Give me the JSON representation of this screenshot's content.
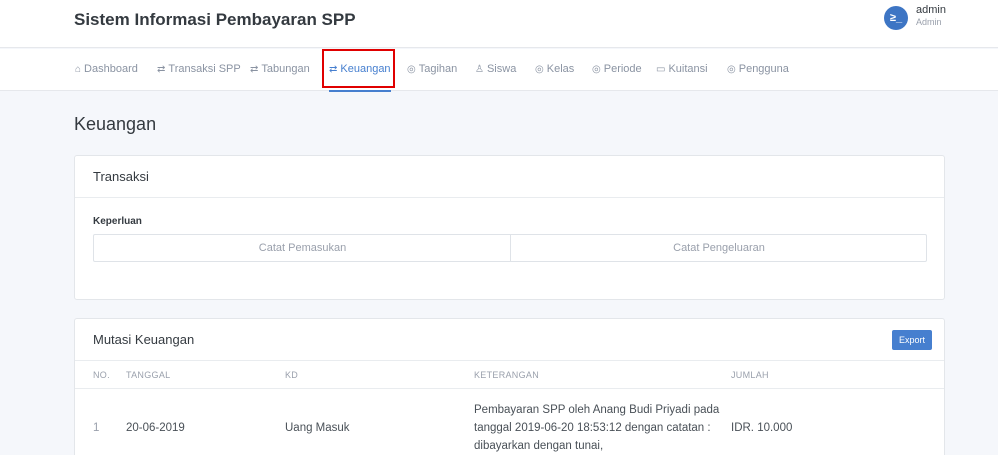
{
  "header": {
    "title": "Sistem Informasi Pembayaran SPP",
    "user_name": "admin",
    "user_role": "Admin",
    "avatar_glyph": "≥_",
    "avatar_icon": "terminal-icon"
  },
  "nav": {
    "items": [
      {
        "label": "Dashboard",
        "icon": "home-icon",
        "glyph": "⌂"
      },
      {
        "label": "Transaksi SPP",
        "icon": "repeat-icon",
        "glyph": "⇄"
      },
      {
        "label": "Tabungan",
        "icon": "repeat-icon",
        "glyph": "⇄"
      },
      {
        "label": "Keuangan",
        "icon": "repeat-icon",
        "glyph": "⇄",
        "active": true
      },
      {
        "label": "Tagihan",
        "icon": "box-icon",
        "glyph": "◎"
      },
      {
        "label": "Siswa",
        "icon": "users-icon",
        "glyph": "♙"
      },
      {
        "label": "Kelas",
        "icon": "box-icon",
        "glyph": "◎"
      },
      {
        "label": "Periode",
        "icon": "box-icon",
        "glyph": "◎"
      },
      {
        "label": "Kuitansi",
        "icon": "folder-icon",
        "glyph": "▭"
      },
      {
        "label": "Pengguna",
        "icon": "box-icon",
        "glyph": "◎"
      }
    ],
    "accent_color": "#467fcf",
    "highlight_color": "#e00000"
  },
  "page": {
    "title": "Keuangan"
  },
  "transaksi": {
    "title": "Transaksi",
    "keperluan_label": "Keperluan",
    "btn_pemasukan": "Catat Pemasukan",
    "btn_pengeluaran": "Catat Pengeluaran"
  },
  "mutasi": {
    "title": "Mutasi Keuangan",
    "export_label": "Export",
    "columns": [
      "NO.",
      "TANGGAL",
      "KD",
      "KETERANGAN",
      "JUMLAH"
    ],
    "rows": [
      {
        "no": "1",
        "tanggal": "20-06-2019",
        "kd": "Uang Masuk",
        "keterangan": [
          "Pembayaran SPP oleh Anang Budi Priyadi pada",
          "tanggal 2019-06-20 18:53:12 dengan catatan :",
          "dibayarkan dengan tunai,"
        ],
        "jumlah": "IDR. 10.000"
      }
    ]
  }
}
